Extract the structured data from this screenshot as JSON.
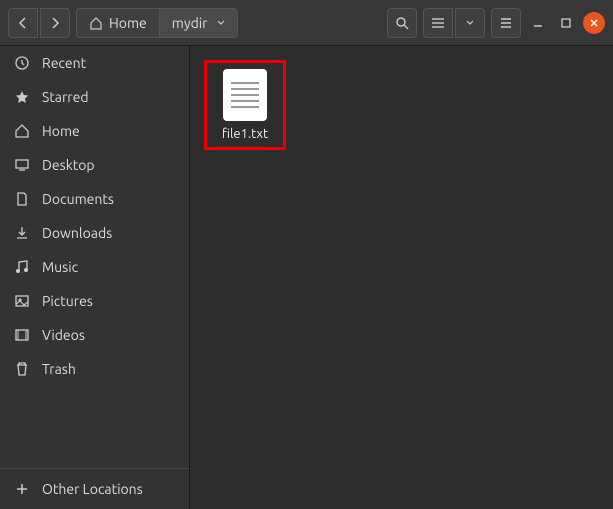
{
  "breadcrumb": {
    "home": "Home",
    "current": "mydir"
  },
  "sidebar": {
    "items": [
      {
        "icon": "clock",
        "label": "Recent"
      },
      {
        "icon": "star",
        "label": "Starred"
      },
      {
        "icon": "home",
        "label": "Home"
      },
      {
        "icon": "desktop",
        "label": "Desktop"
      },
      {
        "icon": "documents",
        "label": "Documents"
      },
      {
        "icon": "downloads",
        "label": "Downloads"
      },
      {
        "icon": "music",
        "label": "Music"
      },
      {
        "icon": "pictures",
        "label": "Pictures"
      },
      {
        "icon": "videos",
        "label": "Videos"
      },
      {
        "icon": "trash",
        "label": "Trash"
      }
    ],
    "other": "Other Locations"
  },
  "files": [
    {
      "name": "file1.txt",
      "selected": true
    }
  ]
}
